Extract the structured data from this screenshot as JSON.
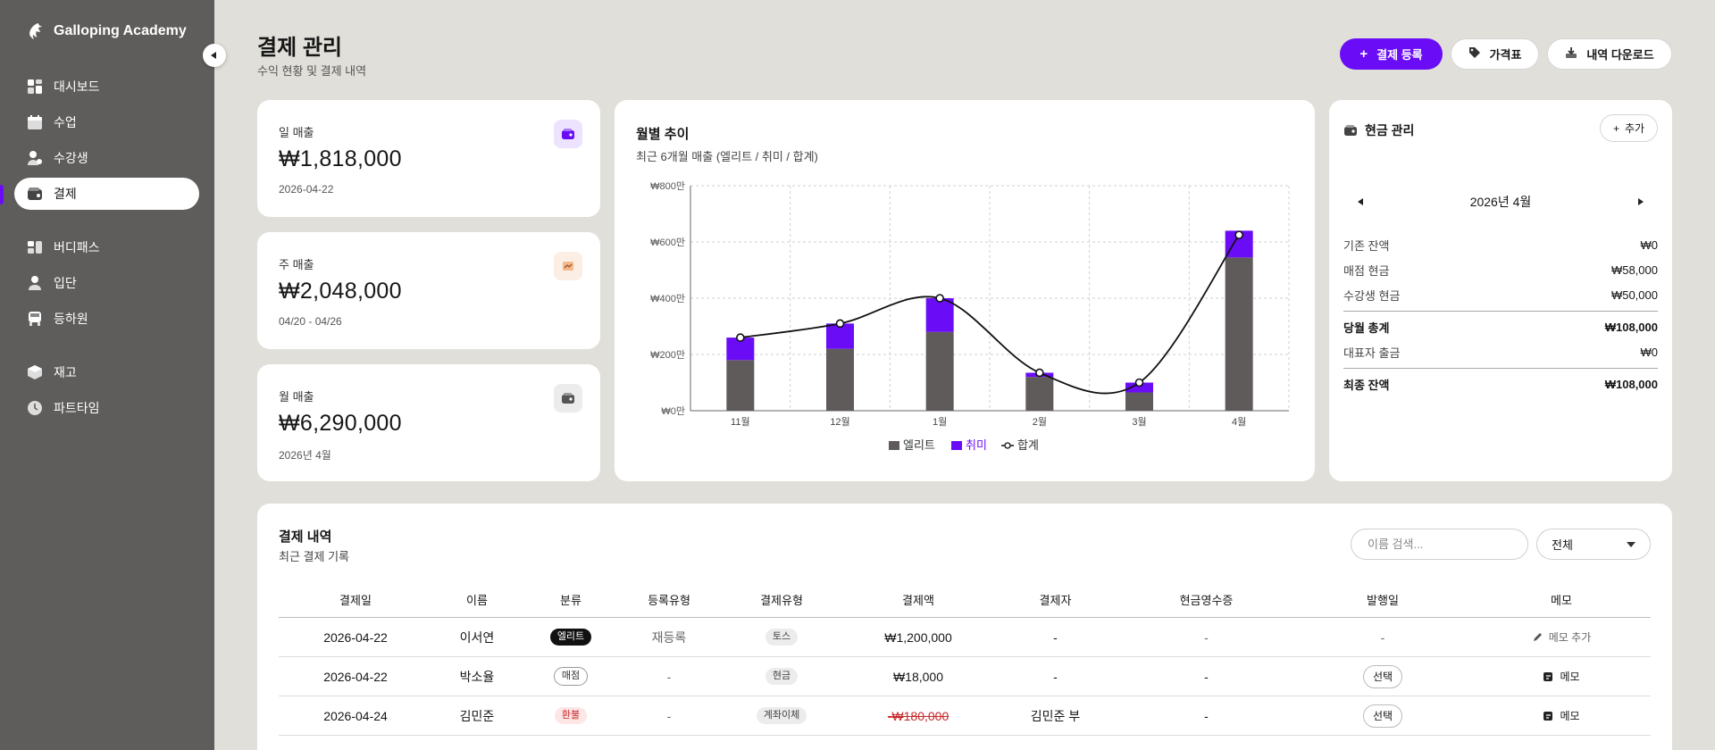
{
  "brand": {
    "name": "Galloping Academy"
  },
  "sidebar": {
    "items": [
      {
        "label": "대시보드",
        "icon": "dashboard-icon"
      },
      {
        "label": "수업",
        "icon": "calendar-icon"
      },
      {
        "label": "수강생",
        "icon": "students-icon"
      },
      {
        "label": "결제",
        "icon": "wallet-icon",
        "active": true
      },
      {
        "label": "버디패스",
        "icon": "pass-icon"
      },
      {
        "label": "입단",
        "icon": "join-icon"
      },
      {
        "label": "등하원",
        "icon": "bus-icon"
      },
      {
        "label": "재고",
        "icon": "box-icon"
      },
      {
        "label": "파트타임",
        "icon": "clock-icon"
      }
    ]
  },
  "header": {
    "title": "결제 관리",
    "subtitle": "수익 현황 및 결제 내역",
    "buttons": {
      "register": "결제 등록",
      "price": "가격표",
      "download": "내역 다운로드"
    }
  },
  "stats": {
    "daily": {
      "label": "일 매출",
      "value": "₩1,818,000",
      "sub": "2026-04-22"
    },
    "weekly": {
      "label": "주 매출",
      "value": "₩2,048,000",
      "sub": "04/20 - 04/26"
    },
    "monthly": {
      "label": "월 매출",
      "value": "₩6,290,000",
      "sub": "2026년 4월"
    }
  },
  "chart": {
    "title": "월별 추이",
    "subtitle": "최근 6개월 매출 (엘리트 / 취미 / 합계)"
  },
  "chart_data": {
    "type": "bar",
    "stacked": true,
    "categories": [
      "11월",
      "12월",
      "1월",
      "2월",
      "3월",
      "4월"
    ],
    "series": [
      {
        "name": "엘리트",
        "values": [
          180,
          220,
          280,
          120,
          65,
          545
        ],
        "color": "#5f5b5a"
      },
      {
        "name": "취미",
        "values": [
          80,
          90,
          120,
          15,
          35,
          95
        ],
        "color": "#6a0df6"
      }
    ],
    "line": {
      "name": "합계",
      "values": [
        260,
        310,
        400,
        135,
        100,
        625
      ],
      "color": "#111111"
    },
    "y_ticks": [
      "₩0만",
      "₩200만",
      "₩400만",
      "₩600만",
      "₩800만"
    ],
    "ylim": [
      0,
      800
    ],
    "grid": true,
    "legend": "bottom"
  },
  "cash": {
    "title": "현금 관리",
    "add_label": "추가",
    "month": "2026년 4월",
    "rows": [
      {
        "label": "기존 잔액",
        "value": "₩0"
      },
      {
        "label": "매점 현금",
        "value": "₩58,000"
      },
      {
        "label": "수강생 현금",
        "value": "₩50,000"
      },
      {
        "label": "당월 총계",
        "value": "₩108,000"
      },
      {
        "label": "대표자 출금",
        "value": "₩0"
      },
      {
        "label": "최종 잔액",
        "value": "₩108,000"
      }
    ]
  },
  "table": {
    "title": "결제 내역",
    "subtitle": "최근 결제 기록",
    "search_placeholder": "이름 검색...",
    "filter_value": "전체",
    "headers": [
      "결제일",
      "이름",
      "분류",
      "등록유형",
      "결제유형",
      "결제액",
      "결제자",
      "현금영수증",
      "발행일",
      "메모"
    ],
    "rows": [
      {
        "date": "2026-04-22",
        "name": "이서연",
        "category": "엘리트",
        "reg_type": "재등록",
        "pay_type": "토스",
        "amount": "₩1,200,000",
        "payer": "-",
        "receipt": "-",
        "issued": "-",
        "memo": "메모 추가"
      },
      {
        "date": "2026-04-22",
        "name": "박소율",
        "category": "매점",
        "reg_type": "-",
        "pay_type": "현금",
        "amount": "₩18,000",
        "payer": "-",
        "receipt": "-",
        "issued": "선택",
        "memo": "메모"
      },
      {
        "date": "2026-04-24",
        "name": "김민준",
        "category": "환불",
        "reg_type": "-",
        "pay_type": "계좌이체",
        "amount": "-₩180,000",
        "payer": "김민준 부",
        "receipt": "-",
        "issued": "선택",
        "memo": "메모"
      }
    ]
  },
  "colors": {
    "accent": "#6a0df6",
    "sidebar": "#5f5d5c",
    "background": "#e0dfd9",
    "refund": "#c62828"
  }
}
